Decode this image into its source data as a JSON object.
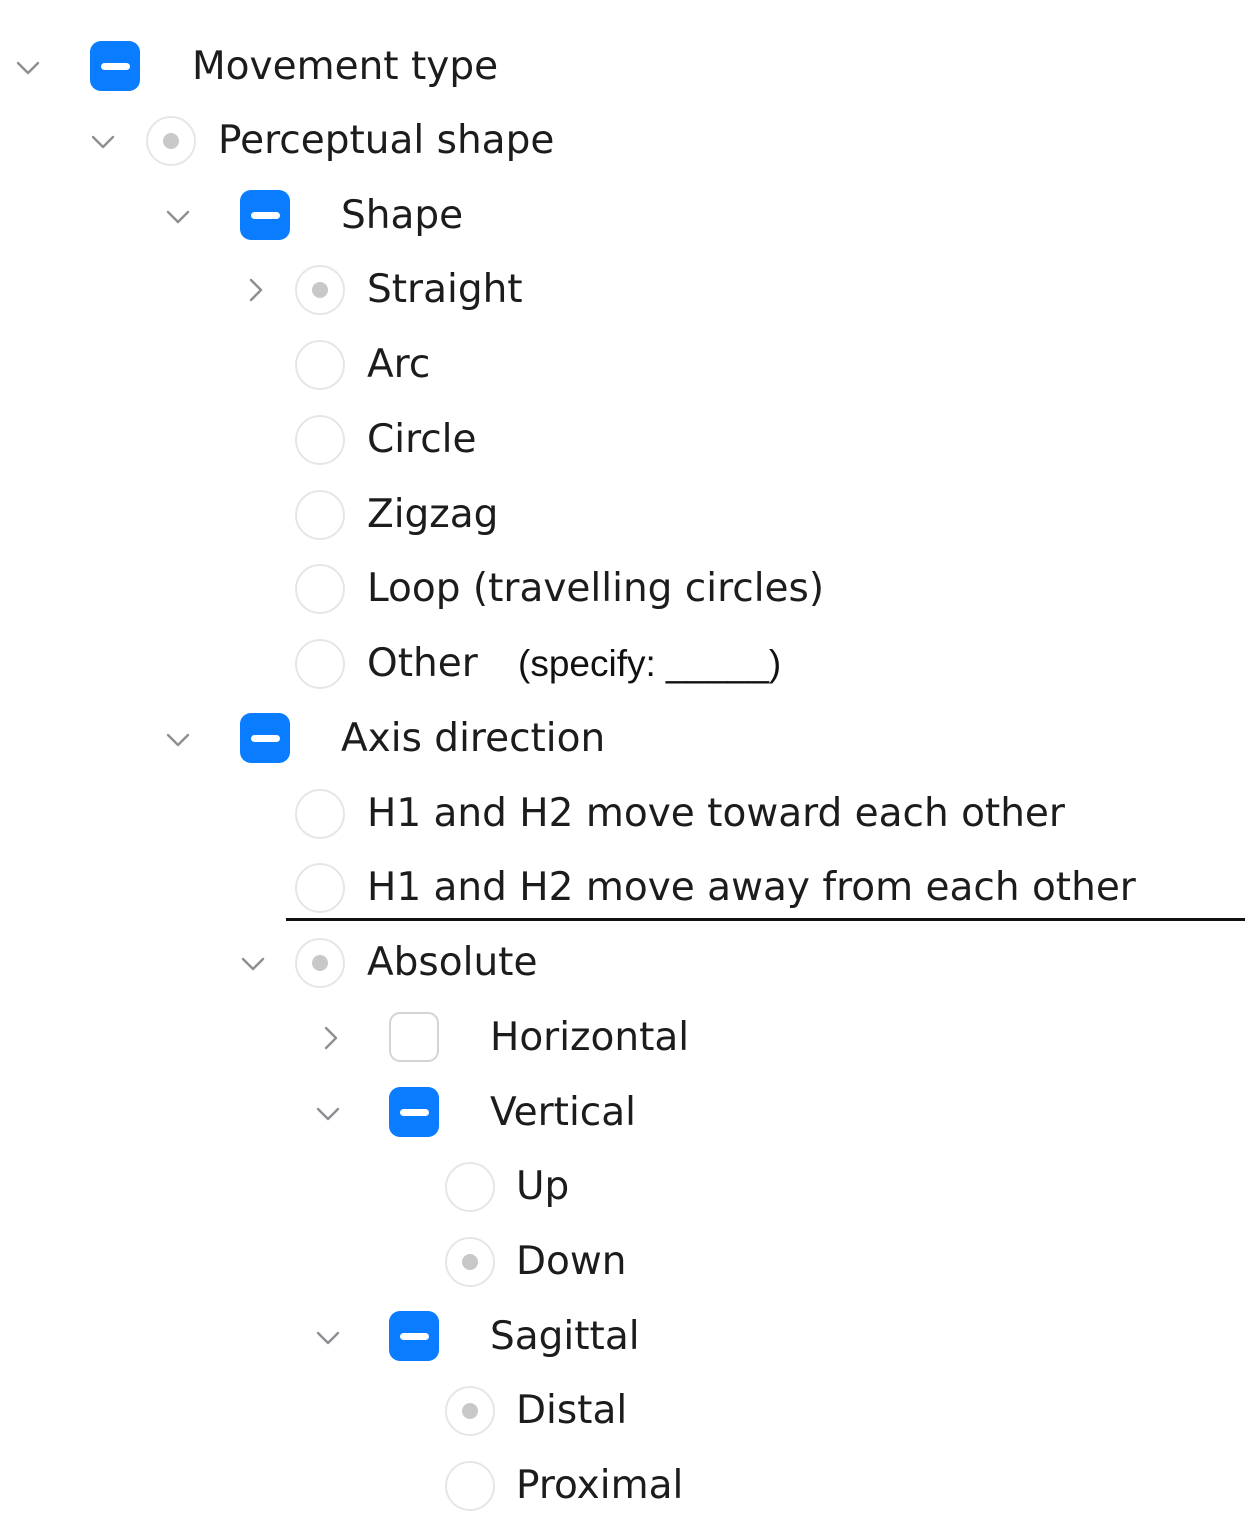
{
  "colors": {
    "accent": "#0a7cff",
    "text": "#1c1c1e",
    "radio_dot": "#c8c8c8"
  },
  "rows": [
    {
      "label": "Movement type",
      "control": "checkbox-mixed",
      "chevron": "down"
    },
    {
      "label": "Perceptual shape",
      "control": "radio-selected",
      "chevron": "down"
    },
    {
      "label": "Shape",
      "control": "checkbox-mixed",
      "chevron": "down"
    },
    {
      "label": "Straight",
      "control": "radio-selected",
      "chevron": "right"
    },
    {
      "label": "Arc",
      "control": "radio",
      "chevron": "none"
    },
    {
      "label": "Circle",
      "control": "radio",
      "chevron": "none"
    },
    {
      "label": "Zigzag",
      "control": "radio",
      "chevron": "none"
    },
    {
      "label": "Loop (travelling circles)",
      "control": "radio",
      "chevron": "none"
    },
    {
      "label": "Other",
      "control": "radio",
      "chevron": "none",
      "annotation": "(specify: _____)"
    },
    {
      "label": "Axis direction",
      "control": "checkbox-mixed",
      "chevron": "down"
    },
    {
      "label": "H1 and H2 move toward each other",
      "control": "radio",
      "chevron": "none"
    },
    {
      "label": "H1 and H2 move away from each other",
      "control": "radio",
      "chevron": "none"
    },
    {
      "label": "Absolute",
      "control": "radio-selected",
      "chevron": "down"
    },
    {
      "label": "Horizontal",
      "control": "checkbox-empty",
      "chevron": "right"
    },
    {
      "label": "Vertical",
      "control": "checkbox-mixed",
      "chevron": "down"
    },
    {
      "label": "Up",
      "control": "radio",
      "chevron": "none"
    },
    {
      "label": "Down",
      "control": "radio-selected",
      "chevron": "none"
    },
    {
      "label": "Sagittal",
      "control": "checkbox-mixed",
      "chevron": "down"
    },
    {
      "label": "Distal",
      "control": "radio-selected",
      "chevron": "none"
    },
    {
      "label": "Proximal",
      "control": "radio",
      "chevron": "none"
    }
  ]
}
